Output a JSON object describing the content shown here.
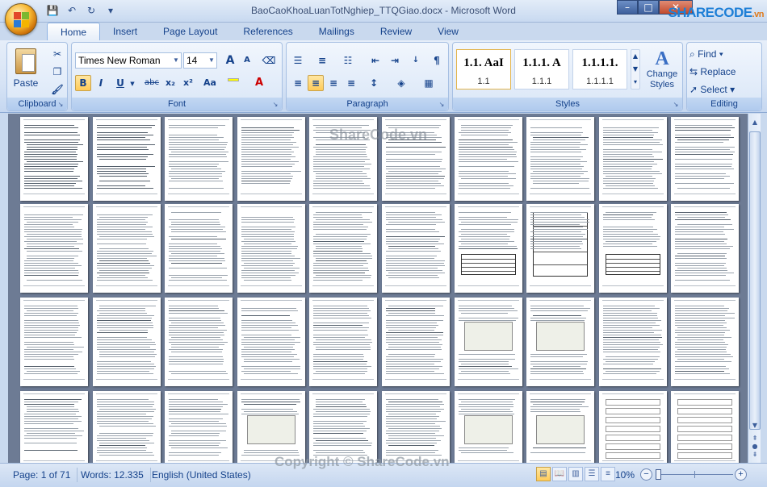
{
  "app": {
    "title": "BaoCaoKhoaLuanTotNghiep_TTQGiao.docx - Microsoft Word",
    "logo_text": "SHARECODE",
    "logo_suffix": ".vn"
  },
  "qat": [
    {
      "name": "save-icon",
      "glyph": "💾"
    },
    {
      "name": "undo-icon",
      "glyph": "↶"
    },
    {
      "name": "redo-icon",
      "glyph": "↻"
    },
    {
      "name": "customize-qat-icon",
      "glyph": "▾"
    }
  ],
  "window_controls": {
    "minimize": "–",
    "maximize": "□",
    "close": "✕"
  },
  "tabs": [
    {
      "label": "Home",
      "active": true
    },
    {
      "label": "Insert"
    },
    {
      "label": "Page Layout"
    },
    {
      "label": "References"
    },
    {
      "label": "Mailings"
    },
    {
      "label": "Review"
    },
    {
      "label": "View"
    }
  ],
  "clipboard": {
    "label": "Clipboard",
    "paste_label": "Paste"
  },
  "font": {
    "label": "Font",
    "family": "Times New Roman",
    "size": "14",
    "grow": "A",
    "shrink": "A",
    "bold": "B",
    "italic": "I",
    "underline": "U",
    "strike": "abc",
    "subscript": "x₂",
    "superscript": "x²",
    "case": "Aa"
  },
  "paragraph": {
    "label": "Paragraph",
    "pilcrow": "¶"
  },
  "styles": {
    "label": "Styles",
    "items": [
      {
        "preview": "1.1.  AaI",
        "name": "1.1"
      },
      {
        "preview": "1.1.1.  A",
        "name": "1.1.1"
      },
      {
        "preview": "1.1.1.1.",
        "name": "1.1.1.1"
      }
    ],
    "change_styles": "Change Styles"
  },
  "editing": {
    "label": "Editing",
    "find": "Find",
    "replace": "Replace",
    "select": "Select"
  },
  "status": {
    "page": "Page: 1 of 71",
    "words": "Words: 12.335",
    "language": "English (United States)",
    "zoom": "10%"
  },
  "watermarks": {
    "center": "ShareCode.vn",
    "bottom": "Copyright © ShareCode.vn"
  }
}
